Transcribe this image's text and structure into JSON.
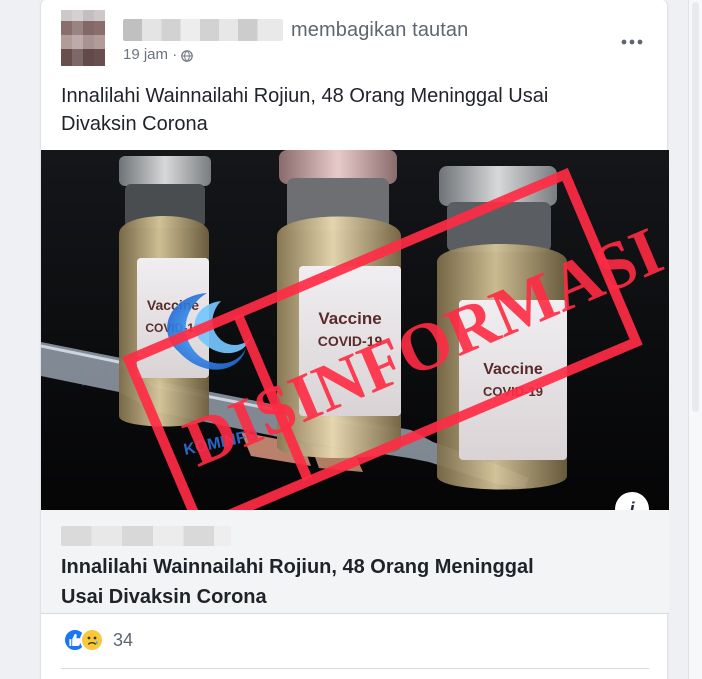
{
  "post": {
    "shared_text": "membagikan tautan",
    "timestamp": "19 jam ·",
    "text": "Innalilahi Wainnailahi Rojiun, 48 Orang Meninggal Usai Divaksin Corona"
  },
  "image": {
    "stamp_text": "DISINFORMASI",
    "logo_text": "KOMINFO",
    "vial_label": "Vaccine",
    "vial_sub": "COVID-19"
  },
  "preview": {
    "title_line_1": "Innalilahi Wainnailahi Rojiun, 48 Orang Meninggal",
    "title_line_2": "Usai Divaksin Corona"
  },
  "reactions": {
    "count": "34"
  }
}
